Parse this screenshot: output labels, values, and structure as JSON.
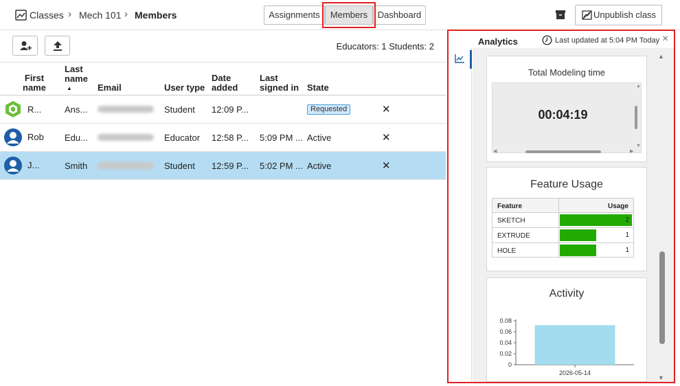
{
  "breadcrumb": {
    "root": "Classes",
    "course": "Mech 101",
    "current": "Members"
  },
  "tabs": [
    "Assignments",
    "Members",
    "Dashboard"
  ],
  "actions": {
    "unpublish": "Unpublish class"
  },
  "toolbar": {
    "counts": "Educators: 1 Students: 2"
  },
  "table": {
    "headers": {
      "first": "First name",
      "last": "Last name",
      "sort": "▲",
      "email": "Email",
      "usertype": "User type",
      "date": "Date added",
      "signed": "Last signed in",
      "state": "State"
    },
    "rows": [
      {
        "first": "R...",
        "last": "Ans...",
        "usertype": "Student",
        "date": "12:09 P...",
        "signed": "",
        "state": "Requested"
      },
      {
        "first": "Rob",
        "last": "Edu...",
        "usertype": "Educator",
        "date": "12:58 P...",
        "signed": "5:09 PM ...",
        "state": "Active"
      },
      {
        "first": "J...",
        "last": "Smith",
        "usertype": "Student",
        "date": "12:59 P...",
        "signed": "5:02 PM ...",
        "state": "Active"
      }
    ]
  },
  "analytics": {
    "title": "Analytics",
    "updated": "Last updated at 5:04 PM Today",
    "modeling": {
      "title": "Total Modeling time",
      "value": "00:04:19"
    },
    "feature": {
      "title": "Feature Usage",
      "col_feature": "Feature",
      "col_usage": "Usage",
      "rows": [
        {
          "name": "SKETCH",
          "value": "2",
          "fraction": 1.0
        },
        {
          "name": "EXTRUDE",
          "value": "1",
          "fraction": 0.5
        },
        {
          "name": "HOLE",
          "value": "1",
          "fraction": 0.5
        }
      ],
      "bar_color": "#22aa00"
    }
  },
  "chart_data": {
    "type": "bar",
    "title": "Activity",
    "categories": [
      "2026-05-14"
    ],
    "values": [
      0.072
    ],
    "yticks": [
      "0.08",
      "0.06",
      "0.04",
      "0.02",
      "0"
    ],
    "ylim": [
      0,
      0.08
    ],
    "bar_color": "#a3dcef"
  }
}
